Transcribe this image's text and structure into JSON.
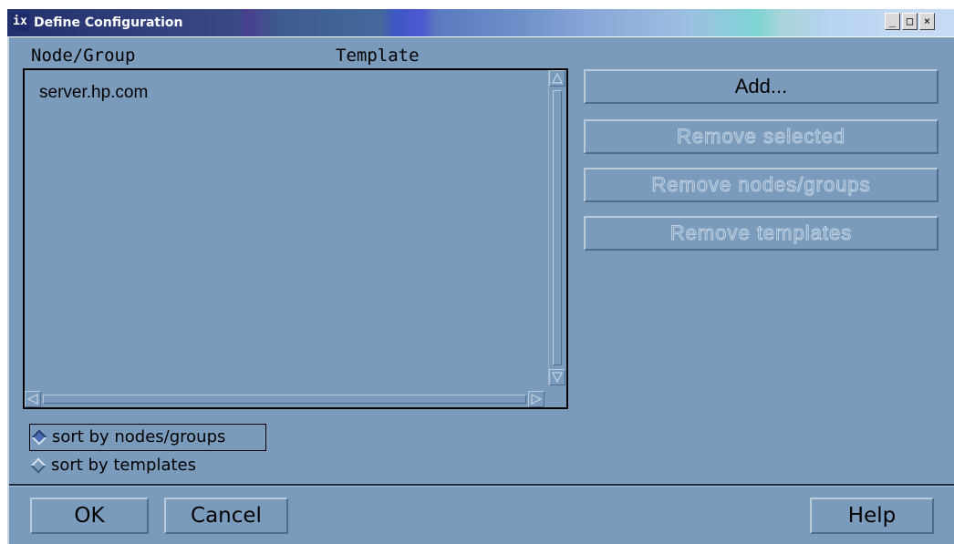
{
  "window": {
    "title": "Define Configuration",
    "icon_glyph": "ix",
    "controls": {
      "minimize": "_",
      "maximize": "□",
      "close": "×"
    }
  },
  "list": {
    "columns": [
      "Node/Group",
      "Template"
    ],
    "rows": [
      {
        "node": "server.hp.com",
        "template": ""
      }
    ]
  },
  "actions": {
    "add": "Add...",
    "remove_selected": "Remove selected",
    "remove_nodes_groups": "Remove nodes/groups",
    "remove_templates": "Remove templates"
  },
  "sort": {
    "options": [
      "sort by nodes/groups",
      "sort by templates"
    ],
    "selected": "sort by nodes/groups"
  },
  "footer": {
    "ok": "OK",
    "cancel": "Cancel",
    "help": "Help"
  },
  "colors": {
    "background": "#7b9bbc",
    "titlebar_start": "#22306e",
    "titlebar_end": "#c6dbf3"
  }
}
